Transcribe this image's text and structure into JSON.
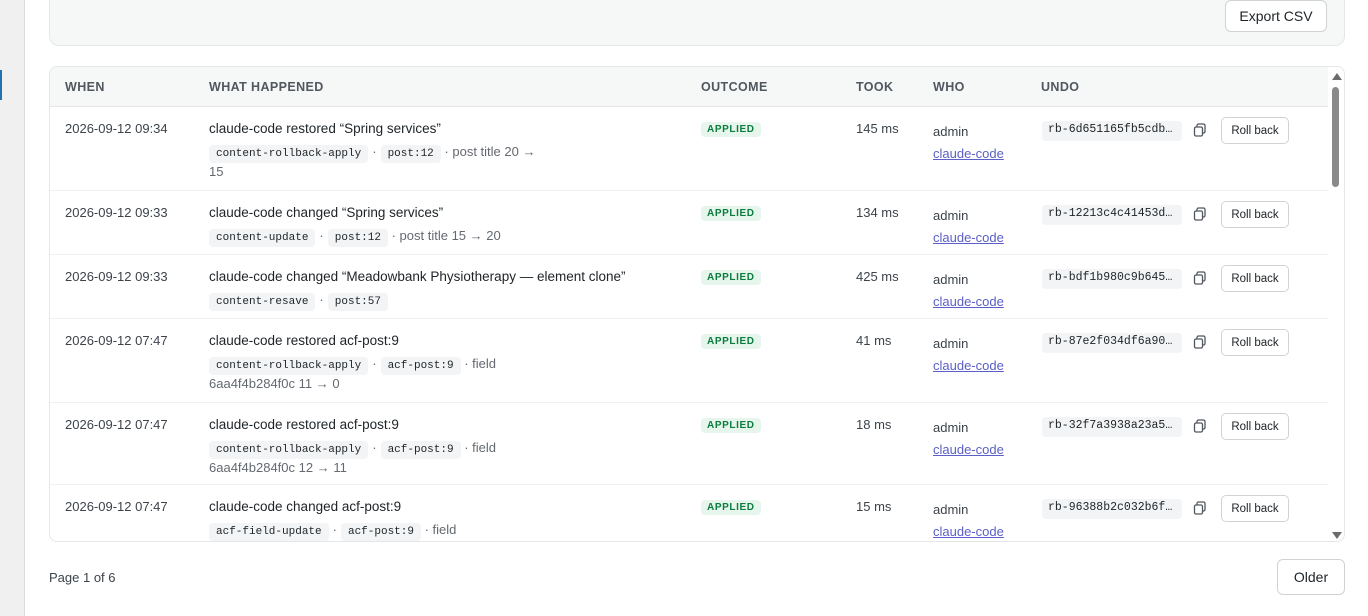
{
  "toolbar": {
    "export_label": "Export CSV"
  },
  "table": {
    "headers": [
      "WHEN",
      "WHAT HAPPENED",
      "OUTCOME",
      "TOOK",
      "WHO",
      "UNDO"
    ],
    "rows": [
      {
        "when": "2026-09-12 09:34",
        "title": "claude-code restored “Spring services”",
        "chips": [
          "content-rollback-apply",
          "post:12"
        ],
        "detail": "· post title 20 → 15",
        "outcome": "APPLIED",
        "took": "145 ms",
        "who": "admin",
        "agent": "claude-code",
        "undo_id": "rb-6d651165fb5cdb…",
        "rollback_label": "Roll back"
      },
      {
        "when": "2026-09-12 09:33",
        "title": "claude-code changed “Spring services”",
        "chips": [
          "content-update",
          "post:12"
        ],
        "detail": "· post title 15 → 20",
        "outcome": "APPLIED",
        "took": "134 ms",
        "who": "admin",
        "agent": "claude-code",
        "undo_id": "rb-12213c4c41453d…",
        "rollback_label": "Roll back"
      },
      {
        "when": "2026-09-12 09:33",
        "title": "claude-code changed “Meadowbank Physiotherapy — element clone”",
        "chips": [
          "content-resave",
          "post:57"
        ],
        "detail": "",
        "outcome": "APPLIED",
        "took": "425 ms",
        "who": "admin",
        "agent": "claude-code",
        "undo_id": "rb-bdf1b980c9b645…",
        "rollback_label": "Roll back"
      },
      {
        "when": "2026-09-12 07:47",
        "title": "claude-code restored acf-post:9",
        "chips": [
          "content-rollback-apply",
          "acf-post:9"
        ],
        "detail": "· field 6aa4f4b284f0c 11 → 0",
        "outcome": "APPLIED",
        "took": "41 ms",
        "who": "admin",
        "agent": "claude-code",
        "undo_id": "rb-87e2f034df6a90…",
        "rollback_label": "Roll back"
      },
      {
        "when": "2026-09-12 07:47",
        "title": "claude-code restored acf-post:9",
        "chips": [
          "content-rollback-apply",
          "acf-post:9"
        ],
        "detail": "· field 6aa4f4b284f0c 12 → 11",
        "outcome": "APPLIED",
        "took": "18 ms",
        "who": "admin",
        "agent": "claude-code",
        "undo_id": "rb-32f7a3938a23a5…",
        "rollback_label": "Roll back"
      },
      {
        "when": "2026-09-12 07:47",
        "title": "claude-code changed acf-post:9",
        "chips": [
          "acf-field-update",
          "acf-post:9"
        ],
        "detail": "· field",
        "outcome": "APPLIED",
        "took": "15 ms",
        "who": "admin",
        "agent": "claude-code",
        "undo_id": "rb-96388b2c032b6f…",
        "rollback_label": "Roll back"
      }
    ]
  },
  "footer": {
    "page_label": "Page 1 of 6",
    "older_label": "Older"
  }
}
